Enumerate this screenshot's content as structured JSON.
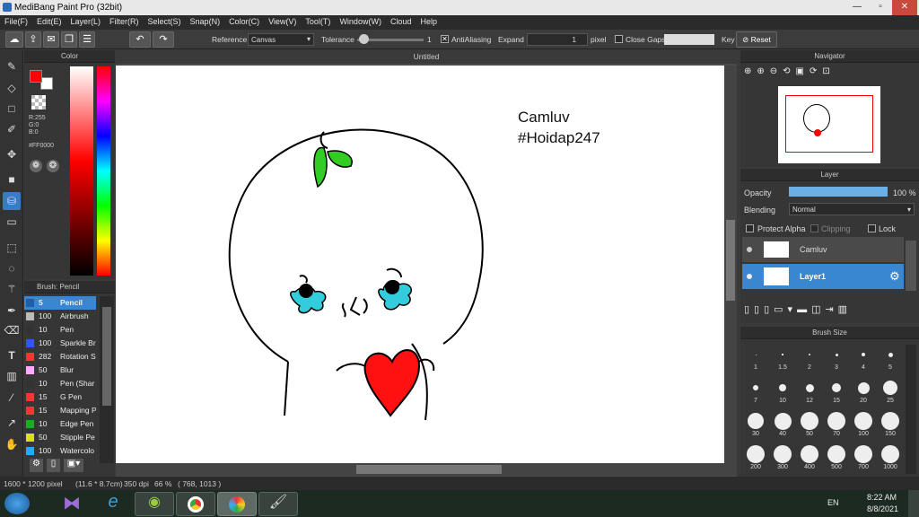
{
  "window": {
    "title": "MediBang Paint Pro (32bit)"
  },
  "menu": [
    "File(F)",
    "Edit(E)",
    "Layer(L)",
    "Filter(R)",
    "Select(S)",
    "Snap(N)",
    "Color(C)",
    "View(V)",
    "Tool(T)",
    "Window(W)",
    "Cloud",
    "Help"
  ],
  "toolbar": {
    "reference_label": "Reference",
    "reference_value": "Canvas",
    "tolerance_label": "Tolerance",
    "tolerance_value": "1",
    "antialiasing_label": "AntiAliasing",
    "expand_label": "Expand",
    "expand_value": "1",
    "expand_unit": "pixel",
    "close_gaps_label": "Close Gaps",
    "key_label": "Key",
    "reset_label": "Reset"
  },
  "color_panel": {
    "title": "Color",
    "r": "R:255",
    "g": "G:0",
    "b": "B:0",
    "hex": "#FF0000",
    "fg_color": "#ff0000",
    "bg_color": "#ffffff"
  },
  "brush_panel": {
    "title": "Brush: Pencil",
    "items": [
      {
        "color": "#1d5fa8",
        "size": "5",
        "name": "Pencil"
      },
      {
        "color": "#bbbbbb",
        "size": "100",
        "name": "Airbrush"
      },
      {
        "color": "#333333",
        "size": "10",
        "name": "Pen"
      },
      {
        "color": "#3355ff",
        "size": "100",
        "name": "Sparkle Br"
      },
      {
        "color": "#ff3333",
        "size": "282",
        "name": "Rotation S"
      },
      {
        "color": "#ffaaff",
        "size": "50",
        "name": "Blur"
      },
      {
        "color": "#333333",
        "size": "10",
        "name": "Pen (Shar"
      },
      {
        "color": "#ff3333",
        "size": "15",
        "name": "G Pen"
      },
      {
        "color": "#ff3333",
        "size": "15",
        "name": "Mapping P"
      },
      {
        "color": "#22aa22",
        "size": "10",
        "name": "Edge Pen"
      },
      {
        "color": "#dddd22",
        "size": "50",
        "name": "Stipple Pe"
      },
      {
        "color": "#22aaff",
        "size": "100",
        "name": "Watercolo"
      }
    ]
  },
  "canvas": {
    "tab": "Untitled",
    "text_line1": "Camluv",
    "text_line2": "#Hoidap247"
  },
  "navigator": {
    "title": "Navigator"
  },
  "layer_panel": {
    "title": "Layer",
    "opacity_label": "Opacity",
    "opacity_value": "100 %",
    "opacity_fraction": 1.0,
    "blending_label": "Blending",
    "blending_value": "Normal",
    "protect_alpha": "Protect Alpha",
    "clipping": "Clipping",
    "lock": "Lock",
    "layers": [
      {
        "name": "Camluv",
        "selected": false
      },
      {
        "name": "Layer1",
        "selected": true
      }
    ]
  },
  "brush_size": {
    "title": "Brush Size",
    "sizes": [
      "1",
      "1.5",
      "2",
      "3",
      "4",
      "5",
      "7",
      "10",
      "12",
      "15",
      "20",
      "25",
      "30",
      "40",
      "50",
      "70",
      "100",
      "150",
      "200",
      "300",
      "400",
      "500",
      "700",
      "1000"
    ]
  },
  "status": {
    "size": "1600 * 1200 pixel",
    "cm": "(11.6 * 8.7cm)",
    "dpi": "350 dpi",
    "zoom": "66 %",
    "coords": "( 768, 1013 )"
  },
  "taskbar": {
    "lang": "EN",
    "time": "8:22 AM",
    "date": "8/8/2021"
  }
}
